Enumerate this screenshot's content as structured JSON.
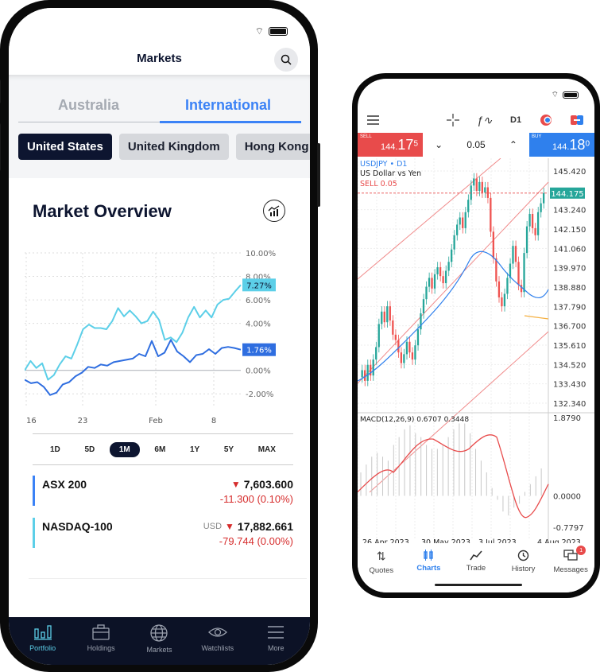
{
  "left_phone": {
    "header": {
      "title": "Markets"
    },
    "tabs": [
      {
        "label": "Australia",
        "active": false
      },
      {
        "label": "International",
        "active": true
      }
    ],
    "regions": [
      {
        "label": "United States",
        "selected": true
      },
      {
        "label": "United Kingdom",
        "selected": false
      },
      {
        "label": "Hong Kong",
        "selected": false
      }
    ],
    "overview": {
      "title": "Market Overview"
    },
    "chart_data": {
      "type": "line",
      "x_ticks": [
        "16",
        "23",
        "Feb",
        "8"
      ],
      "y_ticks": [
        "10.00%",
        "8.00%",
        "6.00%",
        "4.00%",
        "0.00%",
        "-2.00%"
      ],
      "ylim": [
        -3,
        10
      ],
      "series": [
        {
          "name": "NASDAQ-100",
          "color": "#5ccfe8",
          "last_label": "7.27%",
          "values": [
            0,
            0.8,
            0.2,
            0.6,
            -0.8,
            -0.4,
            0.5,
            1.2,
            1.0,
            2.2,
            3.5,
            3.9,
            3.6,
            3.6,
            3.5,
            4.2,
            5.3,
            4.6,
            5.1,
            4.6,
            4.0,
            4.2,
            5.0,
            4.3,
            2.6,
            2.8,
            2.4,
            3.2,
            4.5,
            5.4,
            4.5,
            5.1,
            4.5,
            5.6,
            6.0,
            6.1,
            6.7,
            7.27
          ]
        },
        {
          "name": "ASX 200",
          "color": "#2f6ee0",
          "last_label": "1.76%",
          "values": [
            -0.8,
            -1.1,
            -1.0,
            -1.4,
            -2.1,
            -1.9,
            -1.2,
            -1.0,
            -0.5,
            -0.2,
            0.3,
            0.2,
            0.5,
            0.4,
            0.7,
            0.8,
            0.9,
            1.0,
            1.4,
            1.2,
            2.5,
            1.2,
            1.5,
            2.6,
            1.6,
            1.2,
            0.7,
            1.3,
            1.4,
            1.8,
            1.4,
            1.9,
            2.0,
            1.9,
            1.76
          ]
        }
      ]
    },
    "ranges": [
      {
        "label": "1D"
      },
      {
        "label": "5D"
      },
      {
        "label": "1M",
        "selected": true
      },
      {
        "label": "6M"
      },
      {
        "label": "1Y"
      },
      {
        "label": "5Y"
      },
      {
        "label": "MAX"
      }
    ],
    "indices": [
      {
        "name": "ASX 200",
        "currency": "",
        "price": "7,603.600",
        "change": "-11.300 (0.10%)",
        "color": "#3b82f6"
      },
      {
        "name": "NASDAQ-100",
        "currency": "USD",
        "price": "17,882.661",
        "change": "-79.744 (0.00%)",
        "color": "#5ccfe8"
      }
    ],
    "nav": [
      {
        "label": "Portfolio",
        "icon": "bar-chart-icon",
        "selected": true
      },
      {
        "label": "Holdings",
        "icon": "briefcase-icon"
      },
      {
        "label": "Markets",
        "icon": "globe-icon"
      },
      {
        "label": "Watchlists",
        "icon": "eye-icon"
      },
      {
        "label": "More",
        "icon": "menu-icon"
      }
    ]
  },
  "right_phone": {
    "toolbar": {
      "timeframe": "D1"
    },
    "trade": {
      "sell_label": "SELL",
      "sell_main": "144.",
      "sell_big": "17",
      "sell_sup": "5",
      "lot": "0.05",
      "buy_label": "BUY",
      "buy_main": "144.",
      "buy_big": "18",
      "buy_sup": "0"
    },
    "chart_info": {
      "symbol": "USDJPY",
      "timeframe": "D1",
      "description": "US Dollar vs Yen",
      "position": "SELL 0.05",
      "current_price": "144.175"
    },
    "chart_data": {
      "type": "candlestick",
      "y_ticks": [
        "145.420",
        "143.240",
        "142.150",
        "141.060",
        "139.970",
        "138.880",
        "137.790",
        "136.700",
        "135.610",
        "134.520",
        "133.430",
        "132.340"
      ],
      "x_ticks": [
        "26 Apr 2023",
        "30 May 2023",
        "3 Jul 2023",
        "4 Aug 2023"
      ],
      "macd": {
        "label": "MACD(12,26,9) 0.6707 0.3448",
        "y_ticks": [
          "1.8790",
          "0.0000",
          "-0.7797"
        ]
      }
    },
    "nav": [
      {
        "label": "Quotes"
      },
      {
        "label": "Charts",
        "selected": true
      },
      {
        "label": "Trade"
      },
      {
        "label": "History"
      },
      {
        "label": "Messages",
        "badge": "1"
      }
    ]
  }
}
